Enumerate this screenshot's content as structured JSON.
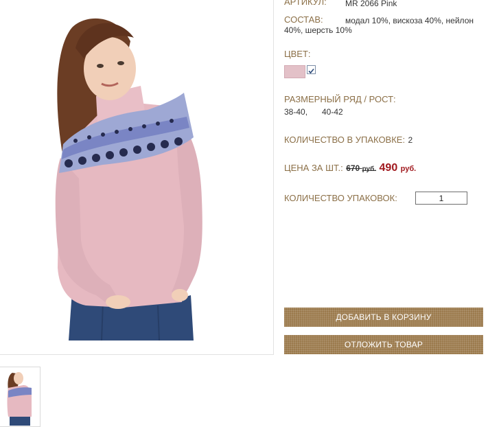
{
  "product": {
    "article_label": "АРТИКУЛ:",
    "article_value": "MR 2066 Pink",
    "composition_label": "СОСТАВ:",
    "composition_line1": "модал 10%, вискоза 40%, нейлон",
    "composition_line2": "40%, шерсть 10%",
    "color_label": "ЦВЕТ:",
    "color_swatch": "#e3c1c8",
    "color_checkbox_checked": true,
    "size_label": "РАЗМЕРНЫЙ РЯД / РОСТ:",
    "sizes": [
      "38-40,",
      "40-42"
    ],
    "pack_qty_label": "КОЛИЧЕСТВО В УПАКОВКЕ:",
    "pack_qty_value": "2",
    "price_label": "ЦЕНА ЗА ШТ.:",
    "old_price": "670",
    "old_currency": "руб.",
    "new_price": "490",
    "new_currency": "руб.",
    "packs_label": "КОЛИЧЕСТВО УПАКОВОК:",
    "packs_value": "1"
  },
  "buttons": {
    "add_to_cart": "ДОБАВИТЬ В КОРЗИНУ",
    "save_item": "ОТЛОЖИТЬ ТОВАР"
  },
  "colors": {
    "label": "#8b6f47",
    "button": "#9b7a4c",
    "new_price": "#a0191e",
    "sweater": "#e6b9c1"
  }
}
